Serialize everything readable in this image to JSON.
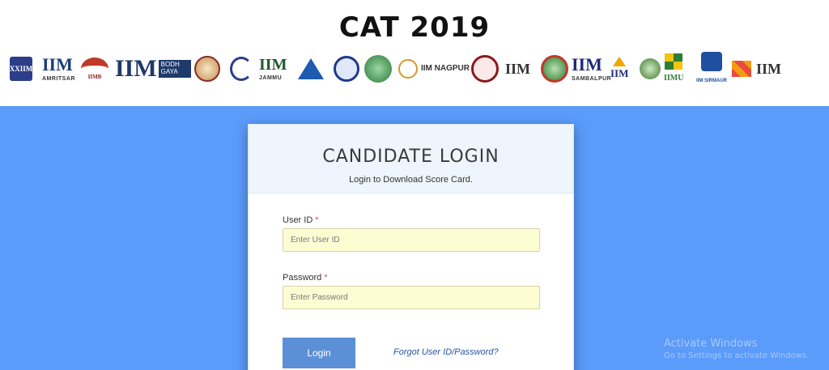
{
  "header": {
    "title": "CAT 2019",
    "logos": [
      {
        "name": "iim-logo-1",
        "text": "XXIIM"
      },
      {
        "name": "iim-amritsar-logo",
        "text": "IIM",
        "sub": "AMRITSAR"
      },
      {
        "name": "iim-bangalore-logo",
        "text": "IIMB"
      },
      {
        "name": "iim-bodhgaya-logo",
        "text": "IIM",
        "sub": "BODH GAYA"
      },
      {
        "name": "iim-calcutta-logo",
        "text": ""
      },
      {
        "name": "iim-indore-logo",
        "text": ""
      },
      {
        "name": "iim-jammu-logo",
        "text": "IIM",
        "sub": "JAMMU"
      },
      {
        "name": "iim-kashipur-logo",
        "text": ""
      },
      {
        "name": "iim-kozhikode-logo",
        "text": ""
      },
      {
        "name": "iim-lucknow-logo",
        "text": ""
      },
      {
        "name": "iim-nagpur-logo",
        "text": "IIM NAGPUR"
      },
      {
        "name": "iim-raipur-logo",
        "text": ""
      },
      {
        "name": "iim-ranchi-logo",
        "text": "IIM"
      },
      {
        "name": "iim-rohtak-logo",
        "text": ""
      },
      {
        "name": "iim-sambalpur-logo",
        "text": "IIM",
        "sub": "SAMBALPUR"
      },
      {
        "name": "iim-trichy-logo",
        "text": "IIM"
      },
      {
        "name": "iim-shillong-logo",
        "text": ""
      },
      {
        "name": "iim-udaipur-logo",
        "text": "IIMU"
      },
      {
        "name": "iim-sirmaur-logo",
        "text": "IIM SIRMAUR"
      },
      {
        "name": "iim-visakhapatnam-logo",
        "text": "IIM"
      }
    ]
  },
  "login": {
    "title": "CANDIDATE LOGIN",
    "subtitle": "Login to Download Score Card.",
    "user_id_label": "User ID",
    "user_id_placeholder": "Enter User ID",
    "user_id_value": "",
    "password_label": "Password",
    "password_placeholder": "Enter Password",
    "password_value": "",
    "required_mark": "*",
    "login_button": "Login",
    "forgot_link": "Forgot User ID/Password?"
  },
  "watermark": {
    "line1": "Activate Windows",
    "line2": "Go to Settings to activate Windows."
  },
  "colors": {
    "page_background": "#5b9bfa",
    "button": "#5b8fd6",
    "input_background": "#fdfdd4",
    "required": "#e24b3b",
    "link": "#2a56a8"
  }
}
